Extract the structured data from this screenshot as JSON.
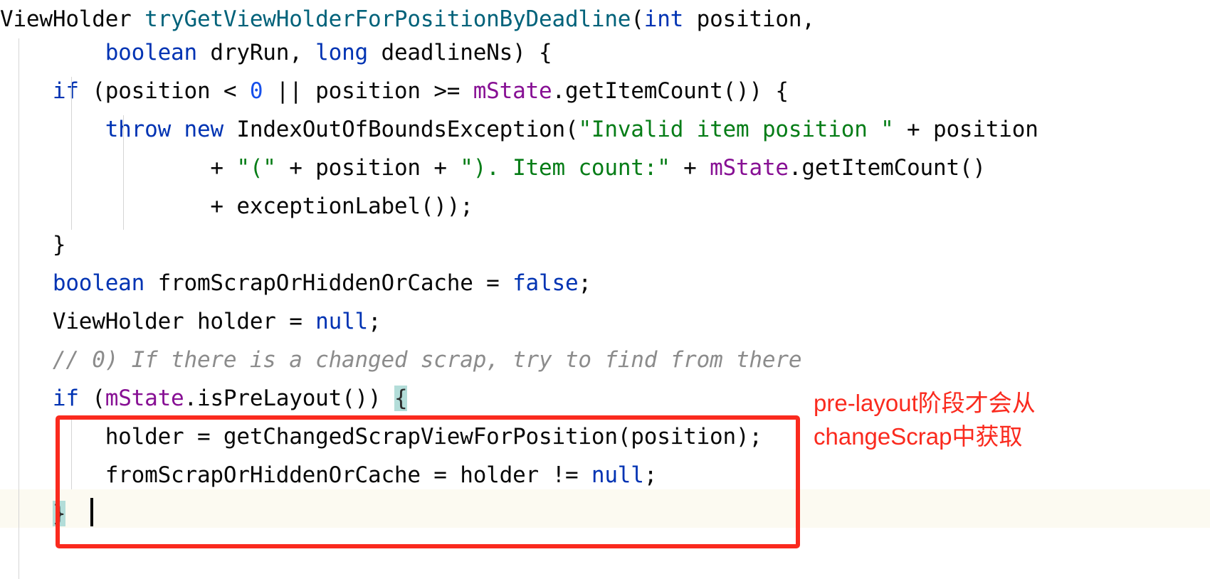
{
  "editor": {
    "language": "java",
    "theme": "light",
    "colors": {
      "background": "#ffffff",
      "text": "#080808",
      "keyword": "#0033b3",
      "method_declaration": "#00627a",
      "field": "#871094",
      "string": "#067d17",
      "number": "#1750eb",
      "comment": "#8c8c8c",
      "brace_match_highlight": "#b3ddd9",
      "current_line": "#fcfaf1",
      "annotation_red": "#fa2a1e",
      "indent_guide": "#d5d5d5"
    }
  },
  "code": {
    "lines": [
      {
        "id": "line-1",
        "indent": "",
        "tokens": [
          {
            "t": "ViewHolder ",
            "c": "plain"
          },
          {
            "t": "tryGetViewHolderForPositionByDeadline",
            "c": "method"
          },
          {
            "t": "(",
            "c": "plain"
          },
          {
            "t": "int",
            "c": "kw"
          },
          {
            "t": " position,",
            "c": "plain"
          }
        ]
      },
      {
        "id": "line-2",
        "indent": "        ",
        "tokens": [
          {
            "t": "boolean",
            "c": "kw"
          },
          {
            "t": " dryRun, ",
            "c": "plain"
          },
          {
            "t": "long",
            "c": "kw"
          },
          {
            "t": " deadlineNs) {",
            "c": "plain"
          }
        ]
      },
      {
        "id": "line-3",
        "indent": "    ",
        "tokens": [
          {
            "t": "if",
            "c": "kw"
          },
          {
            "t": " (position < ",
            "c": "plain"
          },
          {
            "t": "0",
            "c": "num"
          },
          {
            "t": " || position >= ",
            "c": "plain"
          },
          {
            "t": "mState",
            "c": "field"
          },
          {
            "t": ".getItemCount()) {",
            "c": "plain"
          }
        ]
      },
      {
        "id": "line-4",
        "indent": "        ",
        "tokens": [
          {
            "t": "throw",
            "c": "kw"
          },
          {
            "t": " ",
            "c": "plain"
          },
          {
            "t": "new",
            "c": "kw"
          },
          {
            "t": " IndexOutOfBoundsException(",
            "c": "plain"
          },
          {
            "t": "\"Invalid item position \"",
            "c": "str"
          },
          {
            "t": " + position",
            "c": "plain"
          }
        ]
      },
      {
        "id": "line-5",
        "indent": "                ",
        "tokens": [
          {
            "t": "+ ",
            "c": "plain"
          },
          {
            "t": "\"(\"",
            "c": "str"
          },
          {
            "t": " + position + ",
            "c": "plain"
          },
          {
            "t": "\"). Item count:\"",
            "c": "str"
          },
          {
            "t": " + ",
            "c": "plain"
          },
          {
            "t": "mState",
            "c": "field"
          },
          {
            "t": ".getItemCount()",
            "c": "plain"
          }
        ]
      },
      {
        "id": "line-6",
        "indent": "                ",
        "tokens": [
          {
            "t": "+ exceptionLabel());",
            "c": "plain"
          }
        ]
      },
      {
        "id": "line-7",
        "indent": "    ",
        "tokens": [
          {
            "t": "}",
            "c": "plain"
          }
        ]
      },
      {
        "id": "line-8",
        "indent": "    ",
        "tokens": [
          {
            "t": "boolean",
            "c": "kw"
          },
          {
            "t": " fromScrapOrHiddenOrCache = ",
            "c": "plain"
          },
          {
            "t": "false",
            "c": "kw"
          },
          {
            "t": ";",
            "c": "plain"
          }
        ]
      },
      {
        "id": "line-9",
        "indent": "    ",
        "tokens": [
          {
            "t": "ViewHolder holder = ",
            "c": "plain"
          },
          {
            "t": "null",
            "c": "kw"
          },
          {
            "t": ";",
            "c": "plain"
          }
        ]
      },
      {
        "id": "line-10",
        "indent": "    ",
        "tokens": [
          {
            "t": "// 0) If there is a changed scrap, try to find from there",
            "c": "cmt"
          }
        ]
      },
      {
        "id": "line-11",
        "indent": "    ",
        "tokens": [
          {
            "t": "if",
            "c": "kw"
          },
          {
            "t": " (",
            "c": "plain"
          },
          {
            "t": "mState",
            "c": "field"
          },
          {
            "t": ".isPreLayout()) ",
            "c": "plain"
          },
          {
            "t": "{",
            "c": "brace-match"
          }
        ]
      },
      {
        "id": "line-12",
        "indent": "        ",
        "tokens": [
          {
            "t": "holder = getChangedScrapViewForPosition(position);",
            "c": "plain"
          }
        ]
      },
      {
        "id": "line-13",
        "indent": "        ",
        "tokens": [
          {
            "t": "fromScrapOrHiddenOrCache = holder != ",
            "c": "plain"
          },
          {
            "t": "null",
            "c": "kw"
          },
          {
            "t": ";",
            "c": "plain"
          }
        ]
      },
      {
        "id": "line-14",
        "indent": "    ",
        "tokens": [
          {
            "t": "}",
            "c": "brace-match"
          }
        ]
      }
    ]
  },
  "annotation": {
    "name": "pre-layout-note",
    "line1": "pre-layout阶段才会从",
    "line2": "changeScrap中获取",
    "color": "#fa2a1e"
  }
}
